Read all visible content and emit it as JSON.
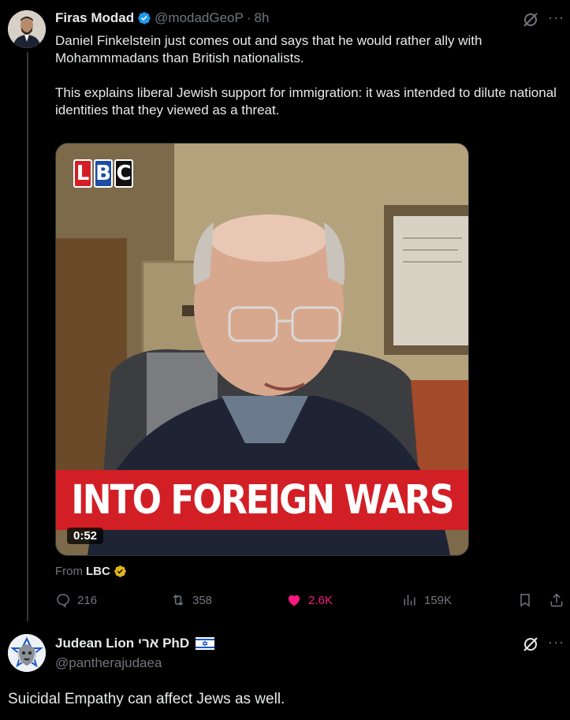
{
  "tweet1": {
    "display_name": "Firas Modad",
    "handle": "@modadGeoP",
    "separator": "·",
    "time": "8h",
    "paragraph1": "Daniel Finkelstein just comes out and says that he would rather ally with Mohammmadans than British nationalists.",
    "paragraph2": "This explains liberal Jewish support for immigration: it was intended to dilute national identities that they viewed as a threat.",
    "media": {
      "logo": [
        "L",
        "B",
        "C"
      ],
      "caption": "INTO FOREIGN WARS",
      "duration": "0:52"
    },
    "from_label": "From",
    "from_source": "LBC",
    "actions": {
      "replies": "216",
      "reposts": "358",
      "likes": "2.6K",
      "views": "159K"
    },
    "colors": {
      "like": "#f91880",
      "verified_blue": "#1d9bf0",
      "verified_gold": "#e2b719"
    }
  },
  "tweet2": {
    "display_name": "Judean Lion ארי PhD",
    "flag": "Israel flag",
    "handle": "@pantherajudaea",
    "text": "Suicidal Empathy can affect Jews as well."
  },
  "icons": {
    "grok": "grok-icon",
    "more": "more-icon",
    "reply": "reply-icon",
    "repost": "repost-icon",
    "like": "heart-icon",
    "views": "views-icon",
    "bookmark": "bookmark-icon",
    "share": "share-icon"
  }
}
